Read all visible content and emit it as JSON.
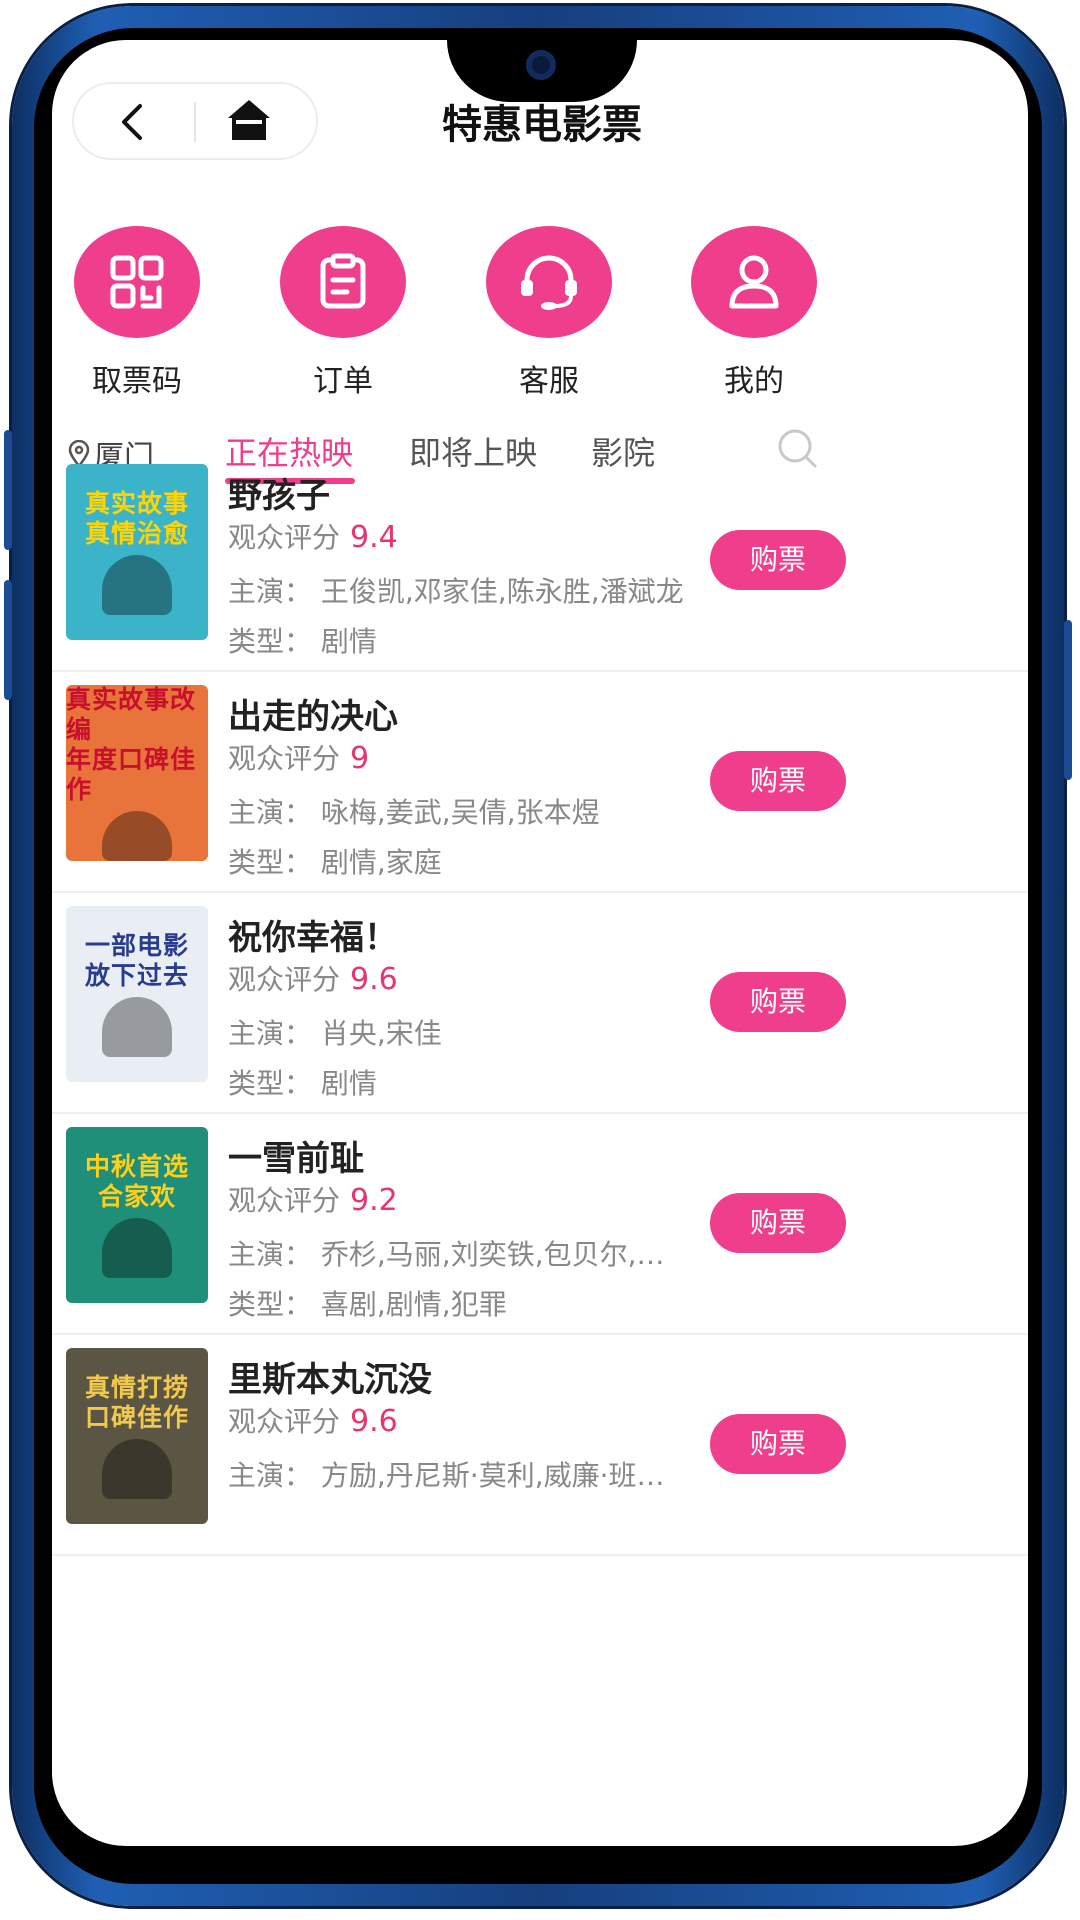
{
  "header": {
    "title": "特惠电影票"
  },
  "menu": [
    {
      "label": "取票码",
      "icon": "ticket-code-icon"
    },
    {
      "label": "订单",
      "icon": "clipboard-icon"
    },
    {
      "label": "客服",
      "icon": "headset-icon"
    },
    {
      "label": "我的",
      "icon": "user-icon"
    }
  ],
  "location": "厦门",
  "tabs": [
    "正在热映",
    "即将上映",
    "影院"
  ],
  "active_tab": "正在热映",
  "rating_label": "观众评分",
  "actors_label": "主演：",
  "genre_label": "类型：",
  "buy_label": "购票",
  "movies": [
    {
      "name": "野孩子",
      "score": "9.4",
      "actors": "王俊凯,邓家佳,陈永胜,潘斌龙",
      "genre": "剧情",
      "poster": {
        "line1": "真实故事",
        "line2": "真情治愈",
        "bg": "#3bb3c8",
        "fg": "#ffd400"
      }
    },
    {
      "name": "出走的决心",
      "score": "9",
      "actors": "咏梅,姜武,吴倩,张本煜",
      "genre": "剧情,家庭",
      "poster": {
        "line1": "真实故事改编",
        "line2": "年度口碑佳作",
        "bg": "#e8743b",
        "fg": "#c8102e"
      }
    },
    {
      "name": "祝你幸福！",
      "score": "9.6",
      "actors": "肖央,宋佳",
      "genre": "剧情",
      "poster": {
        "line1": "一部电影",
        "line2": "放下过去",
        "bg": "#e9eef5",
        "fg": "#2a3c8f"
      }
    },
    {
      "name": "一雪前耻",
      "score": "9.2",
      "actors": "乔杉,马丽,刘奕铁,包贝尔,…",
      "genre": "喜剧,剧情,犯罪",
      "poster": {
        "line1": "中秋首选",
        "line2": "合家欢",
        "bg": "#1f8f7a",
        "fg": "#ffcf1a"
      }
    },
    {
      "name": "里斯本丸沉没",
      "score": "9.6",
      "actors": "方励,丹尼斯·莫利,威廉·班…",
      "genre": "",
      "poster": {
        "line1": "真情打捞",
        "line2": "口碑佳作",
        "bg": "#5b5544",
        "fg": "#f2c94c"
      }
    }
  ]
}
